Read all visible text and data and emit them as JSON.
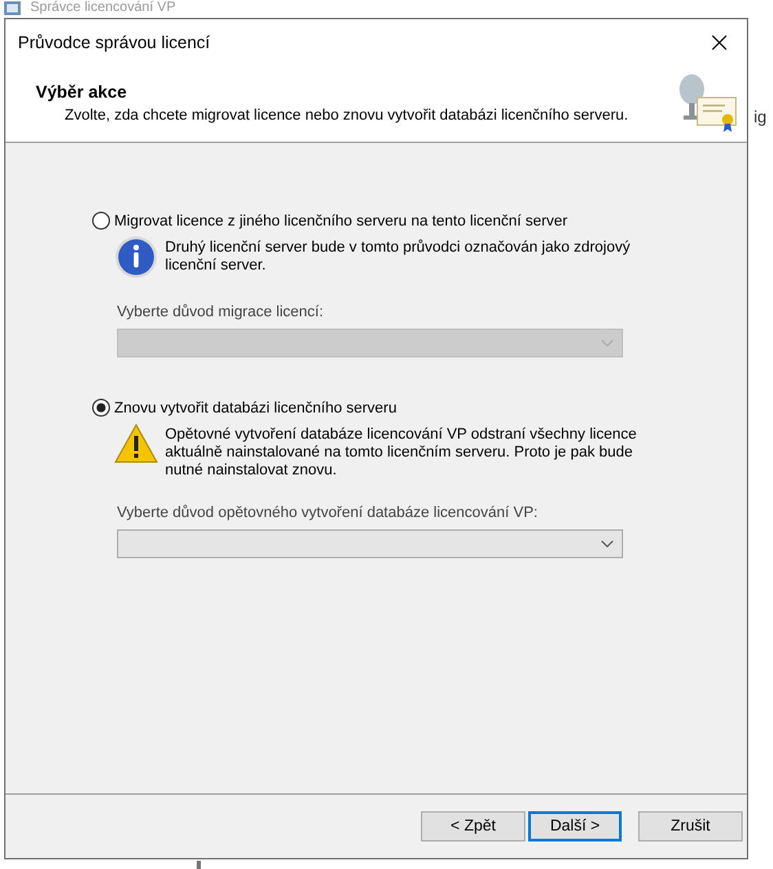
{
  "background_window": {
    "title": "Správce licencování VP",
    "edge_text": "ig"
  },
  "dialog": {
    "title": "Průvodce správou licencí",
    "header": {
      "title": "Výběr akce",
      "subtitle": "Zvolte, zda chcete migrovat licence nebo znovu vytvořit databázi licenčního serveru."
    },
    "options": [
      {
        "label": "Migrovat licence z jiného licenčního serveru na tento licenční server",
        "selected": false,
        "note": {
          "kind": "info",
          "text": "Druhý licenční server bude v tomto průvodci označován jako zdrojový licenční server."
        },
        "field_label": "Vyberte důvod migrace licencí:",
        "dropdown": {
          "disabled": true
        }
      },
      {
        "label": "Znovu vytvořit databázi licenčního serveru",
        "selected": true,
        "note": {
          "kind": "warning",
          "text": "Opětovné vytvoření databáze licencování VP odstraní všechny licence aktuálně nainstalované na tomto licenčním serveru. Proto je pak bude nutné nainstalovat znovu."
        },
        "field_label": "Vyberte důvod opětovného vytvoření databáze licencování VP:",
        "dropdown": {
          "disabled": false
        }
      }
    ],
    "buttons": [
      {
        "label": "< Zpět",
        "focused": false
      },
      {
        "label": "Další >",
        "focused": true
      },
      {
        "label": "Zrušit",
        "focused": false
      }
    ]
  }
}
